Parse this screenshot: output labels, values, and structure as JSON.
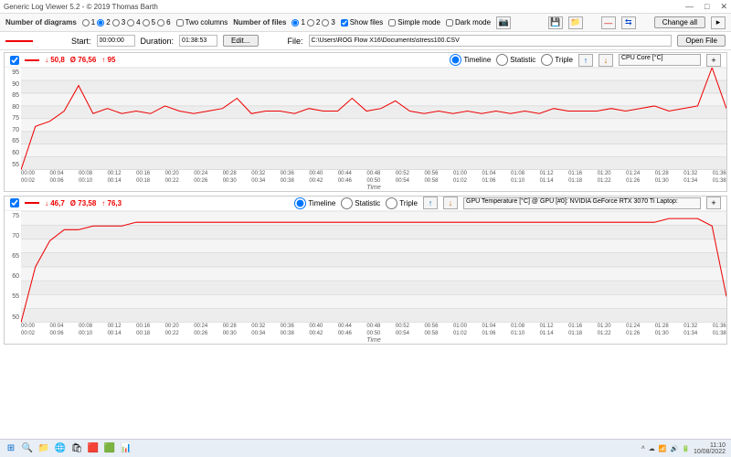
{
  "window": {
    "title": "Generic Log Viewer 5.2 - © 2019 Thomas Barth"
  },
  "toolbar": {
    "diag_label": "Number of diagrams",
    "diag_opts": [
      "1",
      "2",
      "3",
      "4",
      "5",
      "6"
    ],
    "twocol_label": "Two columns",
    "files_label": "Number of files",
    "files_opts": [
      "1",
      "2",
      "3"
    ],
    "showfiles_label": "Show files",
    "simple_label": "Simple mode",
    "dark_label": "Dark mode",
    "change_all": "Change all"
  },
  "file_row": {
    "start_label": "Start:",
    "start_value": "00:00:00",
    "duration_label": "Duration:",
    "duration_value": "01:38:53",
    "edit": "Edit...",
    "file_label": "File:",
    "file_value": "C:\\Users\\ROG Flow X16\\Documents\\stress100.CSV",
    "open_file": "Open File"
  },
  "charts": [
    {
      "stats": {
        "low": "↓ 50,8",
        "avg": "Ø 76,56",
        "high": "↑ 95"
      },
      "view": {
        "timeline": "Timeline",
        "statistic": "Statistic",
        "triple": "Triple"
      },
      "metric": "CPU Core [°C]",
      "xlabel": "Time",
      "yticks": [
        "95",
        "90",
        "85",
        "80",
        "75",
        "70",
        "65",
        "60",
        "55"
      ],
      "xticks_top": [
        "00:00",
        "00:04",
        "00:08",
        "00:12",
        "00:16",
        "00:20",
        "00:24",
        "00:28",
        "00:32",
        "00:36",
        "00:40",
        "00:44",
        "00:48",
        "00:52",
        "00:56",
        "01:00",
        "01:04",
        "01:08",
        "01:12",
        "01:16",
        "01:20",
        "01:24",
        "01:28",
        "01:32",
        "01:36"
      ],
      "xticks_bot": [
        "00:02",
        "00:06",
        "00:10",
        "00:14",
        "00:18",
        "00:22",
        "00:26",
        "00:30",
        "00:34",
        "00:38",
        "00:42",
        "00:46",
        "00:50",
        "00:54",
        "00:58",
        "01:02",
        "01:06",
        "01:10",
        "01:14",
        "01:18",
        "01:22",
        "01:26",
        "01:30",
        "01:34",
        "01:38"
      ]
    },
    {
      "stats": {
        "low": "↓ 46,7",
        "avg": "Ø 73,58",
        "high": "↑ 76,3"
      },
      "view": {
        "timeline": "Timeline",
        "statistic": "Statistic",
        "triple": "Triple"
      },
      "metric": "GPU Temperature [°C] @ GPU [#0]: NVIDIA GeForce RTX 3070 Ti Laptop:",
      "xlabel": "Time",
      "yticks": [
        "75",
        "70",
        "65",
        "60",
        "55",
        "50"
      ],
      "xticks_top": [
        "00:00",
        "00:04",
        "00:08",
        "00:12",
        "00:16",
        "00:20",
        "00:24",
        "00:28",
        "00:32",
        "00:36",
        "00:40",
        "00:44",
        "00:48",
        "00:52",
        "00:56",
        "01:00",
        "01:04",
        "01:08",
        "01:12",
        "01:16",
        "01:20",
        "01:24",
        "01:28",
        "01:32",
        "01:36"
      ],
      "xticks_bot": [
        "00:02",
        "00:06",
        "00:10",
        "00:14",
        "00:18",
        "00:22",
        "00:26",
        "00:30",
        "00:34",
        "00:38",
        "00:42",
        "00:46",
        "00:50",
        "00:54",
        "00:58",
        "01:02",
        "01:06",
        "01:10",
        "01:14",
        "01:18",
        "01:22",
        "01:26",
        "01:30",
        "01:34",
        "01:38"
      ]
    }
  ],
  "chart_data": [
    {
      "type": "line",
      "title": "CPU Core [°C]",
      "xlabel": "Time",
      "ylabel": "°C",
      "ylim": [
        55,
        95
      ],
      "x_minutes": [
        0,
        2,
        4,
        6,
        8,
        10,
        12,
        14,
        16,
        18,
        20,
        22,
        24,
        26,
        28,
        30,
        32,
        34,
        36,
        38,
        40,
        42,
        44,
        46,
        48,
        50,
        52,
        54,
        56,
        58,
        60,
        62,
        64,
        66,
        68,
        70,
        72,
        74,
        76,
        78,
        80,
        82,
        84,
        86,
        88,
        90,
        92,
        94,
        96,
        98
      ],
      "values": [
        55,
        72,
        74,
        78,
        88,
        77,
        79,
        77,
        78,
        77,
        80,
        78,
        77,
        78,
        79,
        83,
        77,
        78,
        78,
        77,
        79,
        78,
        78,
        83,
        78,
        79,
        82,
        78,
        77,
        78,
        77,
        78,
        77,
        78,
        77,
        78,
        77,
        79,
        78,
        78,
        78,
        79,
        78,
        79,
        80,
        78,
        79,
        80,
        95,
        79
      ]
    },
    {
      "type": "line",
      "title": "GPU Temperature [°C]",
      "xlabel": "Time",
      "ylabel": "°C",
      "ylim": [
        47,
        77
      ],
      "x_minutes": [
        0,
        2,
        4,
        6,
        8,
        10,
        12,
        14,
        16,
        18,
        20,
        22,
        24,
        26,
        28,
        30,
        32,
        34,
        36,
        38,
        40,
        42,
        44,
        46,
        48,
        50,
        52,
        54,
        56,
        58,
        60,
        62,
        64,
        66,
        68,
        70,
        72,
        74,
        76,
        78,
        80,
        82,
        84,
        86,
        88,
        90,
        92,
        94,
        96,
        98
      ],
      "values": [
        47,
        62,
        69,
        72,
        72,
        73,
        73,
        73,
        74,
        74,
        74,
        74,
        74,
        74,
        74,
        74,
        74,
        74,
        74,
        74,
        74,
        74,
        74,
        74,
        74,
        74,
        74,
        74,
        74,
        74,
        74,
        74,
        74,
        74,
        74,
        74,
        74,
        74,
        74,
        74,
        74,
        74,
        74,
        74,
        74,
        75,
        75,
        75,
        73,
        54
      ]
    }
  ],
  "taskbar": {
    "time": "11:10",
    "date": "10/08/2022"
  }
}
